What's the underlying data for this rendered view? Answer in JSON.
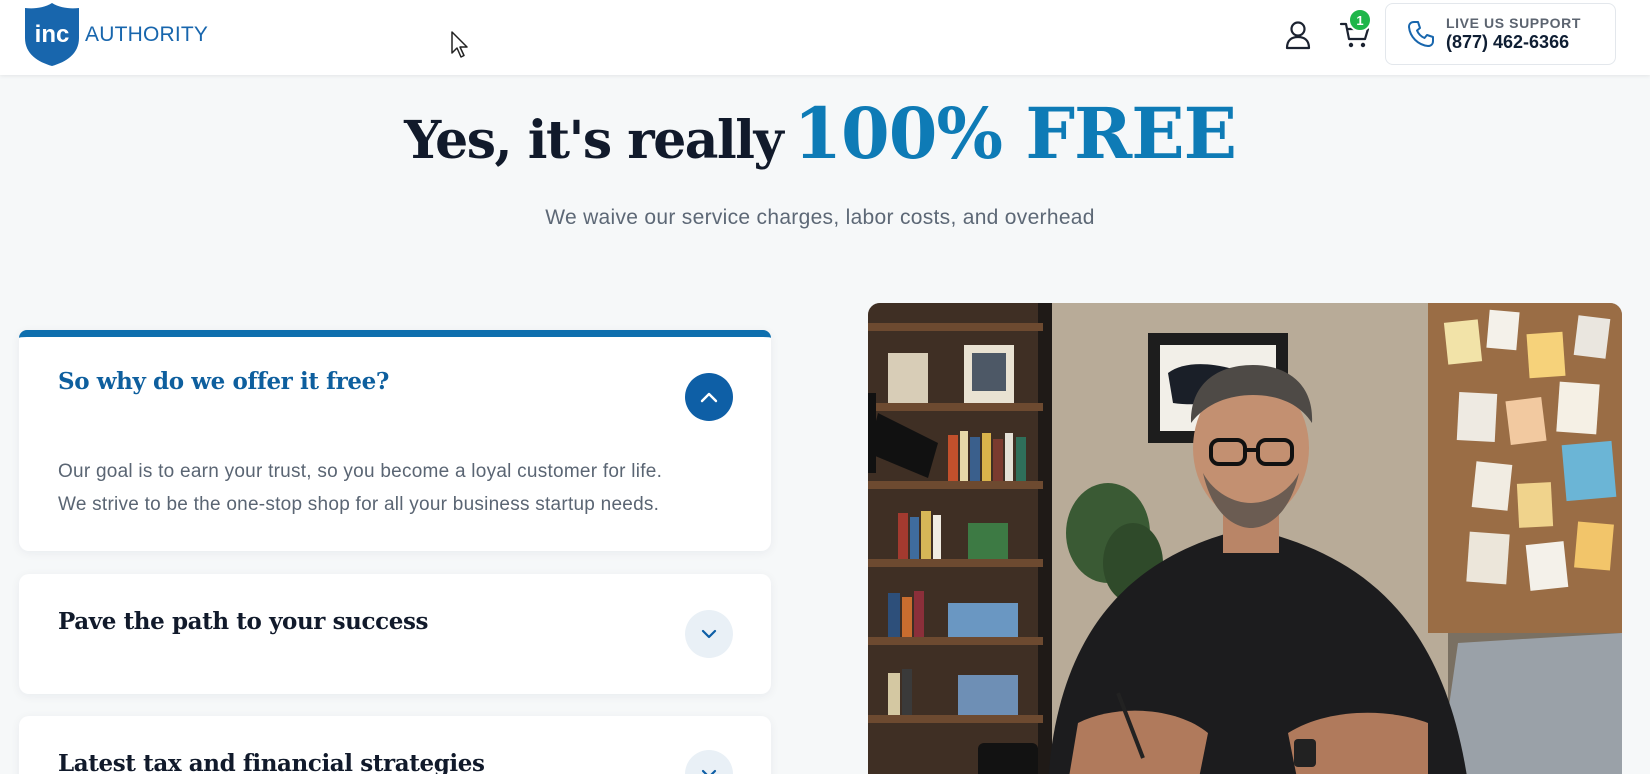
{
  "header": {
    "logo": {
      "badge_text": "inc",
      "text": "AUTHORITY"
    },
    "cart_count": "1",
    "support": {
      "label": "LIVE US SUPPORT",
      "phone": "(877) 462-6366"
    }
  },
  "hero": {
    "title_lead": "Yes, it's really",
    "title_accent": "100% FREE",
    "subtitle": "We waive our service charges, labor costs, and overhead"
  },
  "faq": {
    "items": [
      {
        "question": "So why do we offer it free?",
        "answer_line1": "Our goal is to earn your trust, so you become a loyal customer for life.",
        "answer_line2": "We strive to be the one-stop shop for all your business startup needs.",
        "expanded": true
      },
      {
        "question": "Pave the path to your success",
        "expanded": false
      },
      {
        "question": "Latest tax and financial strategies",
        "expanded": false
      }
    ]
  },
  "colors": {
    "brand_blue": "#1866ad",
    "accent_teal": "#0e7bb6",
    "badge_green": "#1fb64a",
    "toggle_active": "#0e5fa6"
  },
  "icons": {
    "user": "user-icon",
    "cart": "cart-icon",
    "phone": "phone-icon",
    "chevron_up": "chevron-up-icon",
    "chevron_down": "chevron-down-icon"
  }
}
